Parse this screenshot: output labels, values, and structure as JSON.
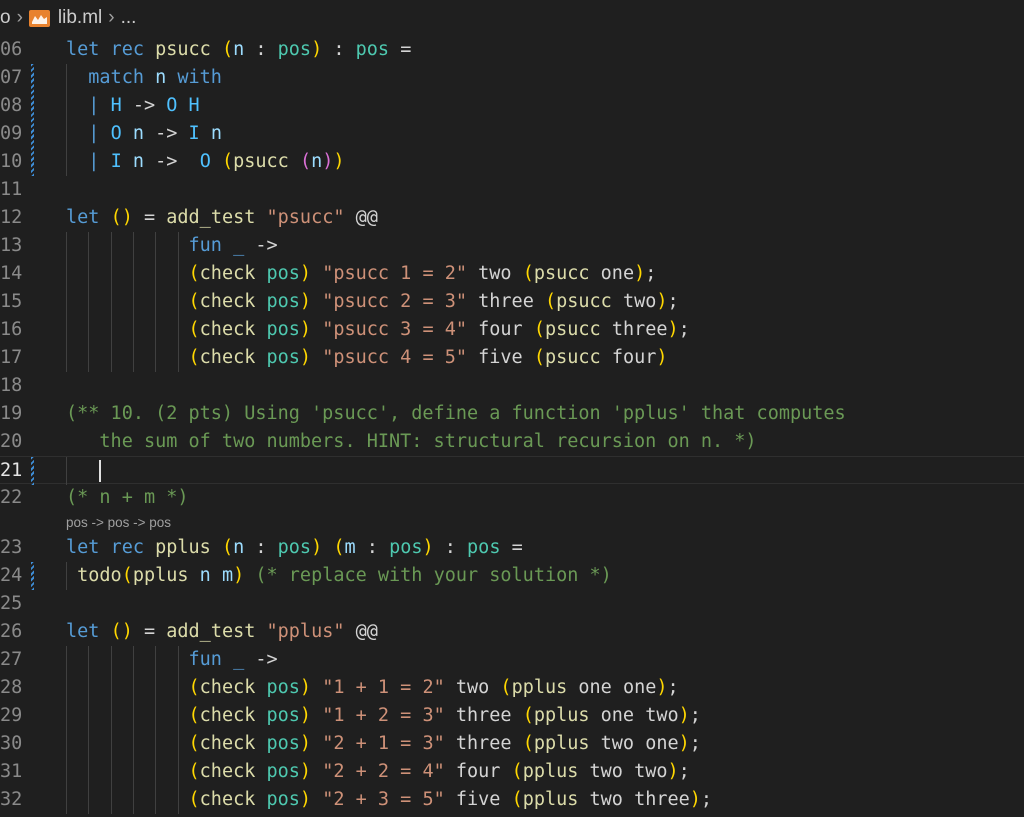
{
  "breadcrumb": {
    "prefix": "o",
    "file": "lib.ml",
    "tail": "..."
  },
  "editor": {
    "lines": [
      {
        "n": "06",
        "mod": false,
        "tokens": [
          [
            "kw",
            "let "
          ],
          [
            "kw",
            "rec "
          ],
          [
            "fn",
            "psucc "
          ],
          [
            "b1",
            "("
          ],
          [
            "var",
            "n "
          ],
          [
            "op",
            ": "
          ],
          [
            "ty",
            "pos"
          ],
          [
            "b1",
            ")"
          ],
          [
            "op",
            " : "
          ],
          [
            "ty",
            "pos "
          ],
          [
            "op",
            "="
          ]
        ]
      },
      {
        "n": "07",
        "mod": true,
        "tokens": [
          [
            "op",
            "  "
          ],
          [
            "kw",
            "match "
          ],
          [
            "var",
            "n "
          ],
          [
            "kw",
            "with"
          ]
        ]
      },
      {
        "n": "08",
        "mod": true,
        "tokens": [
          [
            "op",
            "  "
          ],
          [
            "kw",
            "| "
          ],
          [
            "ctor",
            "H "
          ],
          [
            "op",
            "-> "
          ],
          [
            "ctor",
            "O H"
          ]
        ]
      },
      {
        "n": "09",
        "mod": true,
        "tokens": [
          [
            "op",
            "  "
          ],
          [
            "kw",
            "| "
          ],
          [
            "ctor",
            "O "
          ],
          [
            "var",
            "n "
          ],
          [
            "op",
            "-> "
          ],
          [
            "ctor",
            "I "
          ],
          [
            "var",
            "n"
          ]
        ]
      },
      {
        "n": "10",
        "mod": true,
        "tokens": [
          [
            "op",
            "  "
          ],
          [
            "kw",
            "| "
          ],
          [
            "ctor",
            "I "
          ],
          [
            "var",
            "n "
          ],
          [
            "op",
            "->  "
          ],
          [
            "ctor",
            "O "
          ],
          [
            "b1",
            "("
          ],
          [
            "fn",
            "psucc "
          ],
          [
            "b2",
            "("
          ],
          [
            "var",
            "n"
          ],
          [
            "b2",
            ")"
          ],
          [
            "b1",
            ")"
          ]
        ]
      },
      {
        "n": "11",
        "mod": false,
        "tokens": []
      },
      {
        "n": "12",
        "mod": false,
        "tokens": [
          [
            "kw",
            "let "
          ],
          [
            "b1",
            "()"
          ],
          [
            "op",
            " = "
          ],
          [
            "fn",
            "add_test "
          ],
          [
            "str",
            "\"psucc\" "
          ],
          [
            "op",
            "@@"
          ]
        ]
      },
      {
        "n": "13",
        "mod": false,
        "tokens": [
          [
            "op",
            "           "
          ],
          [
            "kw",
            "fun "
          ],
          [
            "kw",
            "_ "
          ],
          [
            "op",
            "->"
          ]
        ]
      },
      {
        "n": "14",
        "mod": false,
        "tokens": [
          [
            "op",
            "           "
          ],
          [
            "b1",
            "("
          ],
          [
            "fn",
            "check "
          ],
          [
            "ty",
            "pos"
          ],
          [
            "b1",
            ")"
          ],
          [
            "op",
            " "
          ],
          [
            "str",
            "\"psucc 1 = 2\" "
          ],
          [
            "id",
            "two "
          ],
          [
            "b1",
            "("
          ],
          [
            "fn",
            "psucc "
          ],
          [
            "id",
            "one"
          ],
          [
            "b1",
            ")"
          ],
          [
            "op",
            ";"
          ]
        ]
      },
      {
        "n": "15",
        "mod": false,
        "tokens": [
          [
            "op",
            "           "
          ],
          [
            "b1",
            "("
          ],
          [
            "fn",
            "check "
          ],
          [
            "ty",
            "pos"
          ],
          [
            "b1",
            ")"
          ],
          [
            "op",
            " "
          ],
          [
            "str",
            "\"psucc 2 = 3\" "
          ],
          [
            "id",
            "three "
          ],
          [
            "b1",
            "("
          ],
          [
            "fn",
            "psucc "
          ],
          [
            "id",
            "two"
          ],
          [
            "b1",
            ")"
          ],
          [
            "op",
            ";"
          ]
        ]
      },
      {
        "n": "16",
        "mod": false,
        "tokens": [
          [
            "op",
            "           "
          ],
          [
            "b1",
            "("
          ],
          [
            "fn",
            "check "
          ],
          [
            "ty",
            "pos"
          ],
          [
            "b1",
            ")"
          ],
          [
            "op",
            " "
          ],
          [
            "str",
            "\"psucc 3 = 4\" "
          ],
          [
            "id",
            "four "
          ],
          [
            "b1",
            "("
          ],
          [
            "fn",
            "psucc "
          ],
          [
            "id",
            "three"
          ],
          [
            "b1",
            ")"
          ],
          [
            "op",
            ";"
          ]
        ]
      },
      {
        "n": "17",
        "mod": false,
        "tokens": [
          [
            "op",
            "           "
          ],
          [
            "b1",
            "("
          ],
          [
            "fn",
            "check "
          ],
          [
            "ty",
            "pos"
          ],
          [
            "b1",
            ")"
          ],
          [
            "op",
            " "
          ],
          [
            "str",
            "\"psucc 4 = 5\" "
          ],
          [
            "id",
            "five "
          ],
          [
            "b1",
            "("
          ],
          [
            "fn",
            "psucc "
          ],
          [
            "id",
            "four"
          ],
          [
            "b1",
            ")"
          ]
        ]
      },
      {
        "n": "18",
        "mod": false,
        "tokens": []
      },
      {
        "n": "19",
        "mod": false,
        "tokens": [
          [
            "cm",
            "(** 10. (2 pts) Using 'psucc', define a function 'pplus' that computes"
          ]
        ]
      },
      {
        "n": "20",
        "mod": false,
        "tokens": [
          [
            "cm",
            "   the sum of two numbers. HINT: structural recursion on n. *)"
          ]
        ]
      },
      {
        "n": "21",
        "mod": true,
        "current": true,
        "tokens": []
      },
      {
        "n": "22",
        "mod": false,
        "tokens": [
          [
            "cm",
            "(* n + m *)"
          ]
        ]
      },
      {
        "n": "23",
        "mod": false,
        "tokens": [
          [
            "kw",
            "let "
          ],
          [
            "kw",
            "rec "
          ],
          [
            "fn",
            "pplus "
          ],
          [
            "b1",
            "("
          ],
          [
            "var",
            "n "
          ],
          [
            "op",
            ": "
          ],
          [
            "ty",
            "pos"
          ],
          [
            "b1",
            ")"
          ],
          [
            "op",
            " "
          ],
          [
            "b1",
            "("
          ],
          [
            "var",
            "m "
          ],
          [
            "op",
            ": "
          ],
          [
            "ty",
            "pos"
          ],
          [
            "b1",
            ")"
          ],
          [
            "op",
            " : "
          ],
          [
            "ty",
            "pos "
          ],
          [
            "op",
            "="
          ]
        ]
      },
      {
        "n": "24",
        "mod": true,
        "tokens": [
          [
            "op",
            " "
          ],
          [
            "fn",
            "todo"
          ],
          [
            "b1",
            "("
          ],
          [
            "fn",
            "pplus "
          ],
          [
            "var",
            "n m"
          ],
          [
            "b1",
            ")"
          ],
          [
            "op",
            " "
          ],
          [
            "cm",
            "(* replace with your solution *)"
          ]
        ]
      },
      {
        "n": "25",
        "mod": false,
        "tokens": []
      },
      {
        "n": "26",
        "mod": false,
        "tokens": [
          [
            "kw",
            "let "
          ],
          [
            "b1",
            "()"
          ],
          [
            "op",
            " = "
          ],
          [
            "fn",
            "add_test "
          ],
          [
            "str",
            "\"pplus\" "
          ],
          [
            "op",
            "@@"
          ]
        ]
      },
      {
        "n": "27",
        "mod": false,
        "tokens": [
          [
            "op",
            "           "
          ],
          [
            "kw",
            "fun "
          ],
          [
            "kw",
            "_ "
          ],
          [
            "op",
            "->"
          ]
        ]
      },
      {
        "n": "28",
        "mod": false,
        "tokens": [
          [
            "op",
            "           "
          ],
          [
            "b1",
            "("
          ],
          [
            "fn",
            "check "
          ],
          [
            "ty",
            "pos"
          ],
          [
            "b1",
            ")"
          ],
          [
            "op",
            " "
          ],
          [
            "str",
            "\"1 + 1 = 2\" "
          ],
          [
            "id",
            "two "
          ],
          [
            "b1",
            "("
          ],
          [
            "fn",
            "pplus "
          ],
          [
            "id",
            "one one"
          ],
          [
            "b1",
            ")"
          ],
          [
            "op",
            ";"
          ]
        ]
      },
      {
        "n": "29",
        "mod": false,
        "tokens": [
          [
            "op",
            "           "
          ],
          [
            "b1",
            "("
          ],
          [
            "fn",
            "check "
          ],
          [
            "ty",
            "pos"
          ],
          [
            "b1",
            ")"
          ],
          [
            "op",
            " "
          ],
          [
            "str",
            "\"1 + 2 = 3\" "
          ],
          [
            "id",
            "three "
          ],
          [
            "b1",
            "("
          ],
          [
            "fn",
            "pplus "
          ],
          [
            "id",
            "one two"
          ],
          [
            "b1",
            ")"
          ],
          [
            "op",
            ";"
          ]
        ]
      },
      {
        "n": "30",
        "mod": false,
        "tokens": [
          [
            "op",
            "           "
          ],
          [
            "b1",
            "("
          ],
          [
            "fn",
            "check "
          ],
          [
            "ty",
            "pos"
          ],
          [
            "b1",
            ")"
          ],
          [
            "op",
            " "
          ],
          [
            "str",
            "\"2 + 1 = 3\" "
          ],
          [
            "id",
            "three "
          ],
          [
            "b1",
            "("
          ],
          [
            "fn",
            "pplus "
          ],
          [
            "id",
            "two one"
          ],
          [
            "b1",
            ")"
          ],
          [
            "op",
            ";"
          ]
        ]
      },
      {
        "n": "31",
        "mod": false,
        "tokens": [
          [
            "op",
            "           "
          ],
          [
            "b1",
            "("
          ],
          [
            "fn",
            "check "
          ],
          [
            "ty",
            "pos"
          ],
          [
            "b1",
            ")"
          ],
          [
            "op",
            " "
          ],
          [
            "str",
            "\"2 + 2 = 4\" "
          ],
          [
            "id",
            "four "
          ],
          [
            "b1",
            "("
          ],
          [
            "fn",
            "pplus "
          ],
          [
            "id",
            "two two"
          ],
          [
            "b1",
            ")"
          ],
          [
            "op",
            ";"
          ]
        ]
      },
      {
        "n": "32",
        "mod": false,
        "tokens": [
          [
            "op",
            "           "
          ],
          [
            "b1",
            "("
          ],
          [
            "fn",
            "check "
          ],
          [
            "ty",
            "pos"
          ],
          [
            "b1",
            ")"
          ],
          [
            "op",
            " "
          ],
          [
            "str",
            "\"2 + 3 = 5\" "
          ],
          [
            "id",
            "five "
          ],
          [
            "b1",
            "("
          ],
          [
            "fn",
            "pplus "
          ],
          [
            "id",
            "two three"
          ],
          [
            "b1",
            ")"
          ],
          [
            "op",
            ";"
          ]
        ]
      }
    ],
    "inlay_hint": "pos -> pos -> pos"
  }
}
